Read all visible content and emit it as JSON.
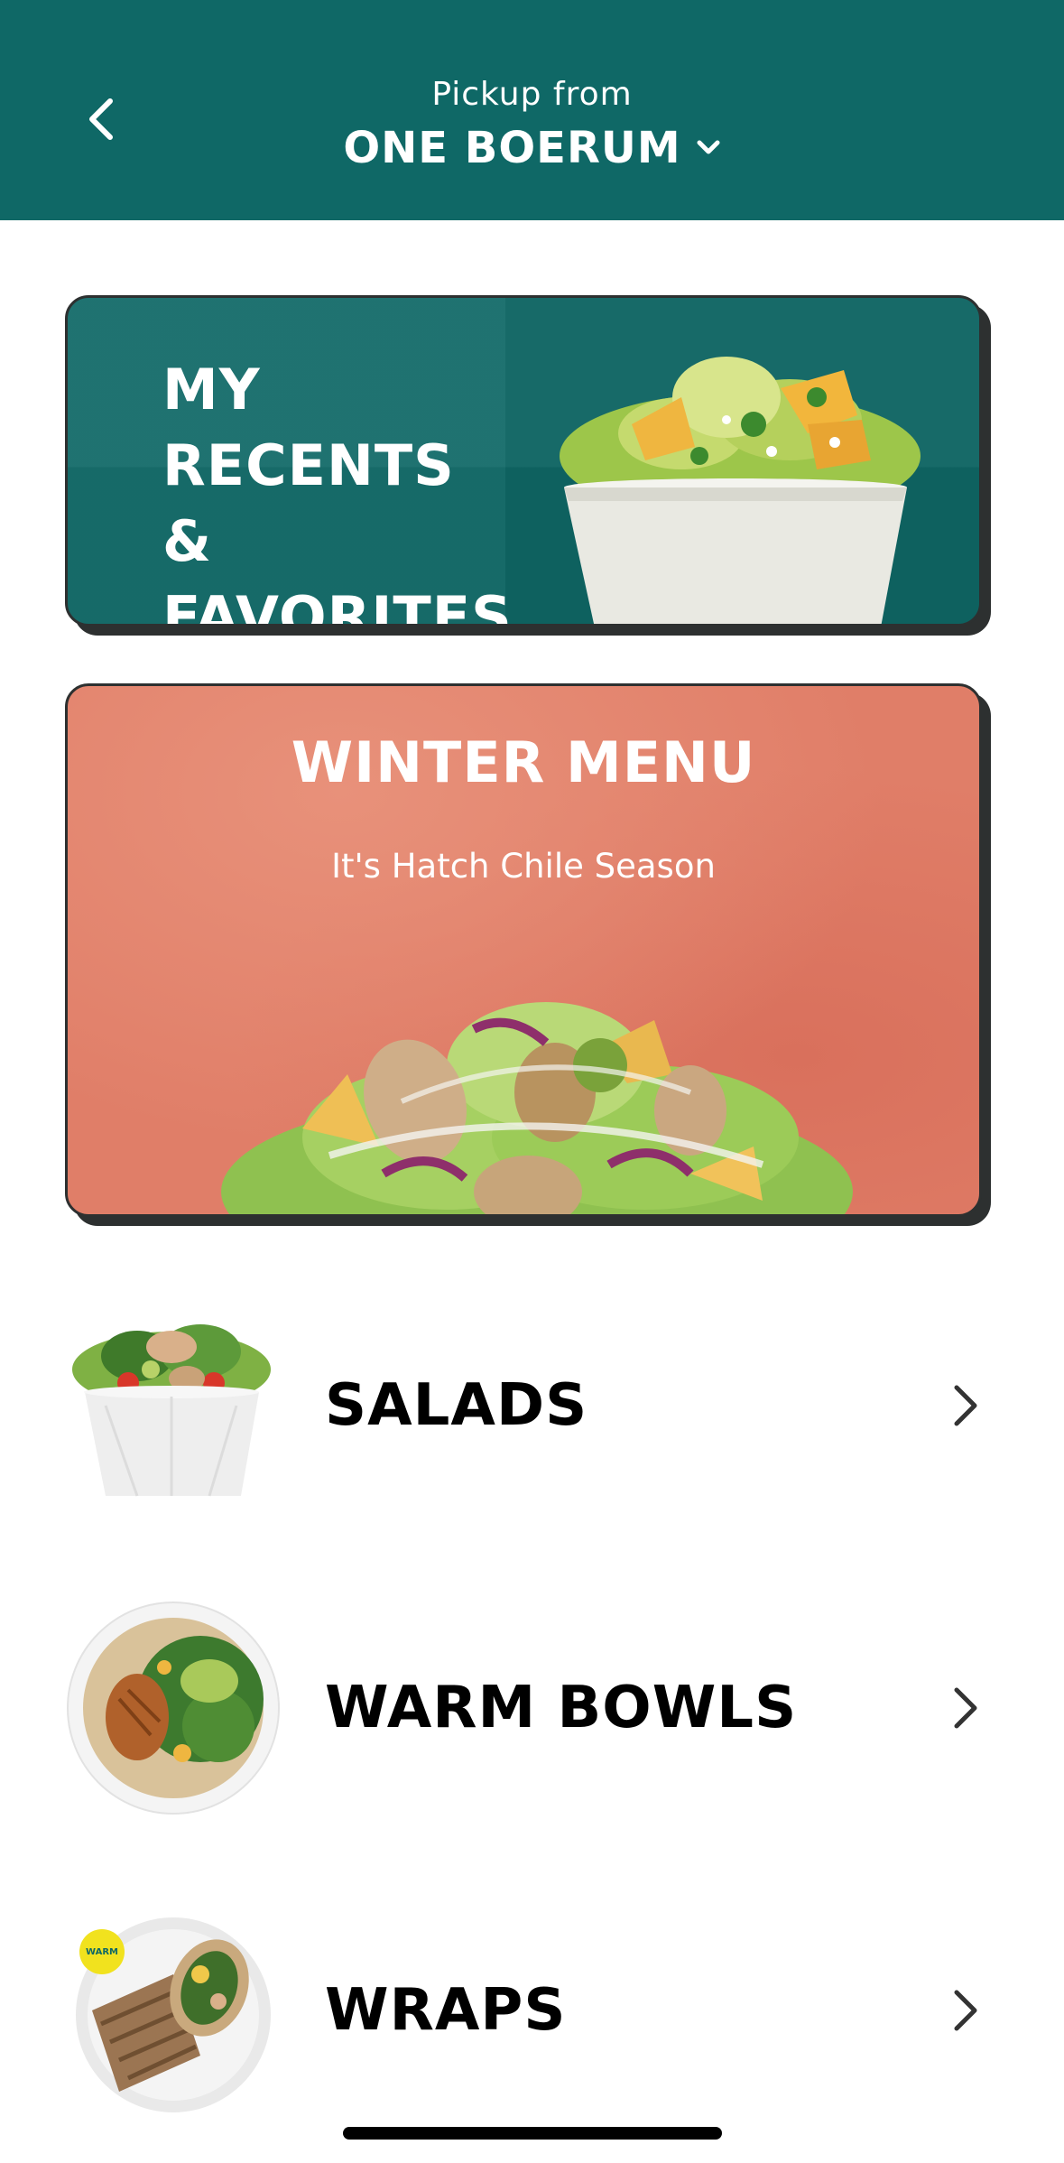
{
  "colors": {
    "brand_teal": "#0f6866",
    "winter_coral": "#e07e68",
    "card_border": "#2d3030"
  },
  "header": {
    "back_icon": "chevron-left-icon",
    "pickup_label": "Pickup from",
    "store_name": "ONE BOERUM",
    "dropdown_icon": "chevron-down-icon"
  },
  "cards": {
    "recents": {
      "title": "MY\nRECENTS &\nFAVORITES",
      "image": "salad-bowl-image"
    },
    "winter": {
      "title": "WINTER MENU",
      "subtitle": "It's Hatch Chile Season",
      "image": "salad-image"
    }
  },
  "menu": {
    "items": [
      {
        "label": "SALADS",
        "image": "salad-bowl-thumbnail",
        "icon": "chevron-right-icon"
      },
      {
        "label": "WARM BOWLS",
        "image": "warm-bowl-thumbnail",
        "icon": "chevron-right-icon"
      },
      {
        "label": "WRAPS",
        "image": "wrap-thumbnail",
        "badge": "WARM",
        "icon": "chevron-right-icon"
      }
    ]
  }
}
